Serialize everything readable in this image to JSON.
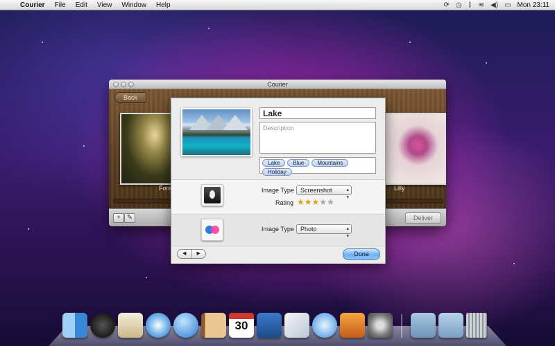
{
  "menubar": {
    "apple": "",
    "app_name": "Courier",
    "items": [
      "File",
      "Edit",
      "View",
      "Window",
      "Help"
    ],
    "status_icons": [
      "sync-icon",
      "time-machine-icon",
      "bluetooth-icon",
      "wifi-icon",
      "volume-icon",
      "battery-icon"
    ],
    "clock": "Mon 23:11"
  },
  "window": {
    "title": "Courier",
    "back_label": "Back",
    "shelf_labels": {
      "left": "Fore",
      "right": "Lilly"
    },
    "deliver_label": "Deliver",
    "bottom_buttons": {
      "add": "+",
      "edit": "✎"
    }
  },
  "sheet": {
    "title_value": "Lake",
    "description_placeholder": "Description",
    "tags": [
      "Lake",
      "Blue",
      "Mountains",
      "Holiday"
    ],
    "service1": {
      "icon": "flame-service-icon",
      "image_type_label": "Image Type",
      "image_type_value": "Screenshot",
      "rating_label": "Rating",
      "rating": 3,
      "rating_max": 5
    },
    "service2": {
      "icon": "flickr-icon",
      "image_type_label": "Image Type",
      "image_type_value": "Photo"
    },
    "nav": {
      "prev": "◀",
      "next": "▶"
    },
    "done_label": "Done"
  },
  "dock": {
    "calendar_day": "30",
    "items": [
      "finder-icon",
      "dashboard-icon",
      "mail-icon",
      "safari-icon",
      "ichat-icon",
      "address-book-icon",
      "ical-icon",
      "courier-icon",
      "preview-icon",
      "itunes-icon",
      "iphoto-icon",
      "system-preferences-icon",
      "applications-folder-icon",
      "documents-folder-icon",
      "trash-icon"
    ]
  }
}
